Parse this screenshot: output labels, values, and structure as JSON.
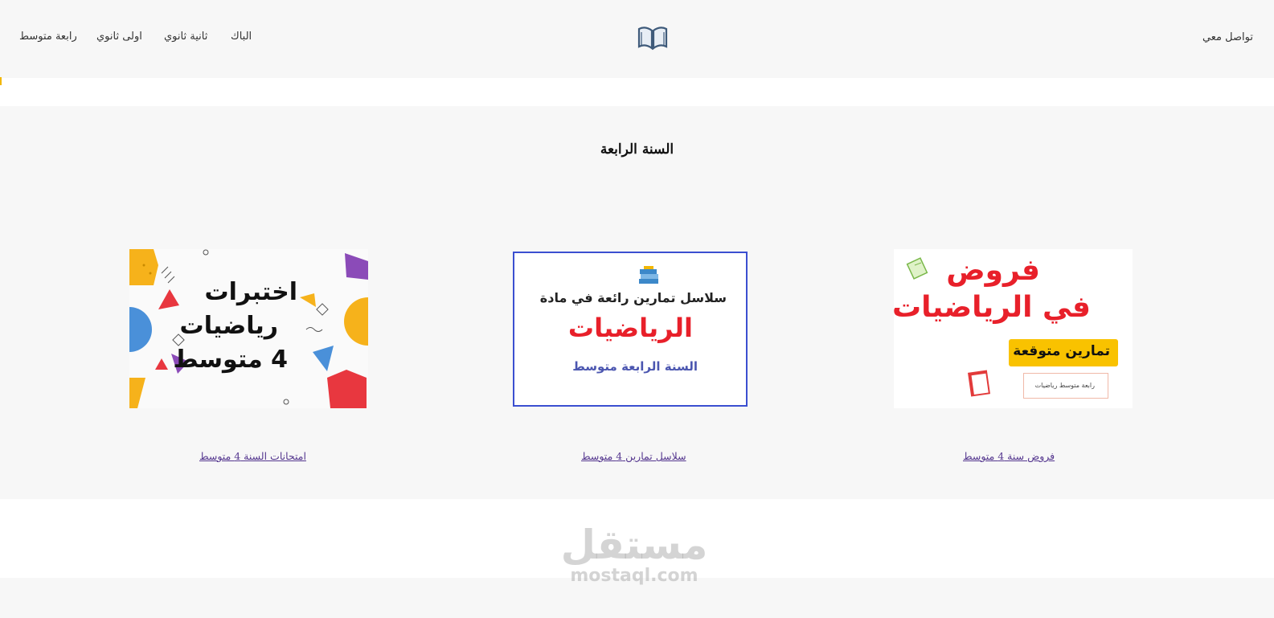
{
  "header": {
    "nav": [
      {
        "label": "رابعة متوسط"
      },
      {
        "label": "اولى ثانوي"
      },
      {
        "label": "ثانية ثانوي"
      },
      {
        "label": "الباك"
      }
    ],
    "contact_label": "تواصل معي",
    "logo_icon": "open-book-icon"
  },
  "section": {
    "title": "السنة الرابعة",
    "cards": [
      {
        "link": "امتحانات السنة 4 متوسط",
        "image_lines": [
          "اختبرات",
          "رياضيات",
          "4 متوسط"
        ]
      },
      {
        "link": "سلاسل تمارين 4 متوسط",
        "image_lines": [
          "سلاسل تمارين رائعة في مادة",
          "الرياضيات",
          "السنة الرابعة متوسط"
        ],
        "image_icon": "books-icon"
      },
      {
        "link": "فروض سنة 4 متوسط",
        "image_lines": [
          "فروض",
          "في الرياضيات",
          "تمارين متوقعة",
          "رابعة متوسط رياضيات"
        ],
        "image_icons": [
          "notebook-icon",
          "red-book-icon"
        ]
      }
    ]
  },
  "watermark": {
    "arabic": "مستقل",
    "latin": "mostaql.com"
  },
  "colors": {
    "link": "#55378f",
    "accent_yellow": "#f2b705",
    "frame_blue": "#3b4fd0",
    "red": "#e8202a"
  }
}
